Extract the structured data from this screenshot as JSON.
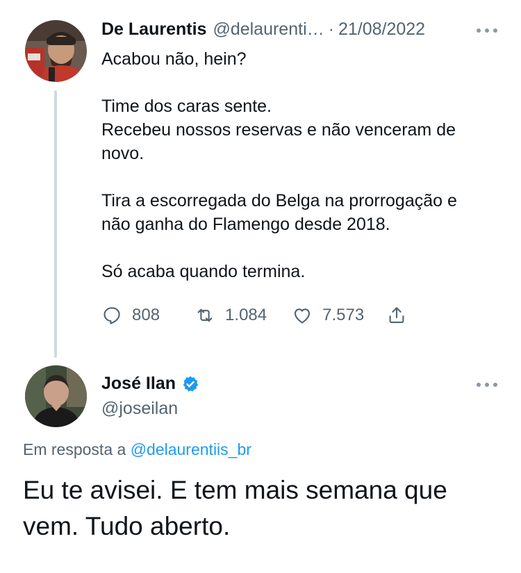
{
  "tweet1": {
    "author_name": "De Laurentis",
    "handle": "@delaurenti…",
    "separator": "·",
    "date": "21/08/2022",
    "avatar_icon": "profile-photo-man-with-beanie",
    "more_icon": "more-horizontal-icon",
    "paragraphs": [
      [
        "Acabou não, hein?"
      ],
      [
        "Time dos caras sente.",
        "Recebeu nossos reservas e não venceram de",
        "novo."
      ],
      [
        "Tira a escorregada do Belga na prorrogação e",
        "não ganha do Flamengo desde 2018."
      ],
      [
        "Só acaba quando termina."
      ]
    ],
    "stats": {
      "replies": "808",
      "retweets": "1.084",
      "likes": "7.573"
    }
  },
  "tweet2": {
    "author_name": "José Ilan",
    "handle": "@joseilan",
    "verified": true,
    "verified_color": "#1d9bf0",
    "avatar_icon": "profile-photo-man-in-black-shirt",
    "more_icon": "more-horizontal-icon",
    "reply_prefix": "Em resposta a",
    "reply_mention": "@delaurentiis_br",
    "text_lines": [
      "Eu te avisei. E tem mais semana que",
      "vem. Tudo aberto."
    ]
  },
  "colors": {
    "text_primary": "#0f1419",
    "text_secondary": "#536471",
    "link": "#1d9bf0",
    "thread_line": "#cfd9de"
  }
}
